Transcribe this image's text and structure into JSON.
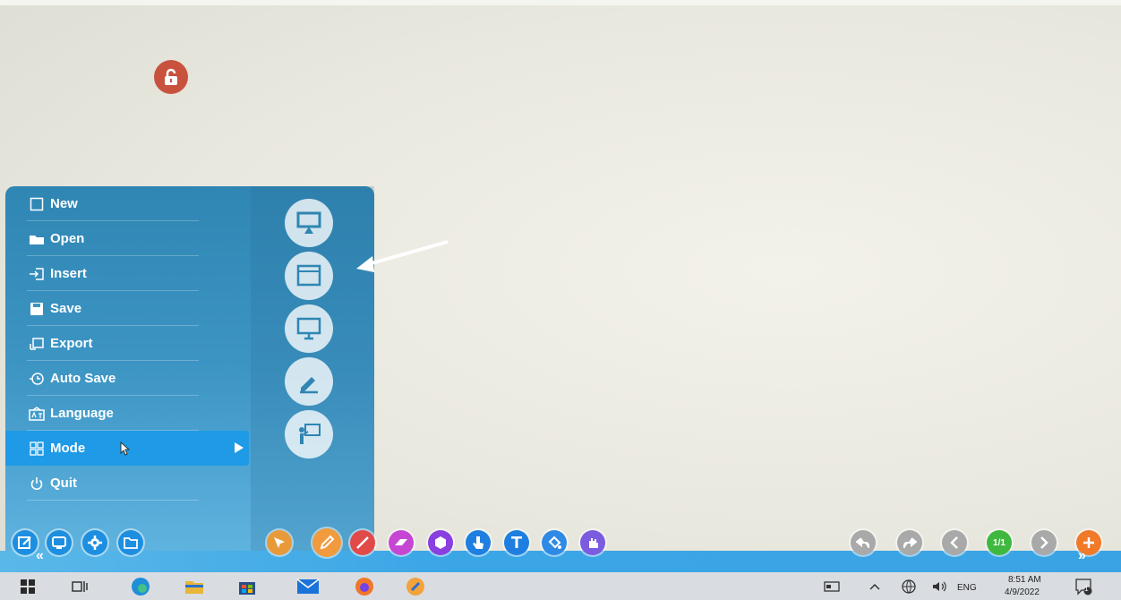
{
  "menu": {
    "items": [
      {
        "label": "New",
        "icon": "new-file-icon"
      },
      {
        "label": "Open",
        "icon": "folder-icon"
      },
      {
        "label": "Insert",
        "icon": "insert-icon"
      },
      {
        "label": "Save",
        "icon": "save-icon"
      },
      {
        "label": "Export",
        "icon": "export-icon"
      },
      {
        "label": "Auto Save",
        "icon": "auto-save-icon"
      },
      {
        "label": "Language",
        "icon": "language-icon"
      },
      {
        "label": "Mode",
        "icon": "mode-grid-icon",
        "active": true
      },
      {
        "label": "Quit",
        "icon": "power-icon"
      }
    ]
  },
  "submenu": {
    "items": [
      {
        "icon": "presentation-board-icon"
      },
      {
        "icon": "window-mode-icon"
      },
      {
        "icon": "desktop-monitor-icon"
      },
      {
        "icon": "pen-annotate-icon"
      },
      {
        "icon": "teacher-board-icon"
      }
    ]
  },
  "toolbar": {
    "left_buttons": [
      {
        "icon": "edit-icon",
        "color": "#1e8fe0"
      },
      {
        "icon": "screen-icon",
        "color": "#1e8fe0"
      },
      {
        "icon": "settings-gear-icon",
        "color": "#1e8fe0"
      },
      {
        "icon": "open-folder-icon",
        "color": "#1e8fe0"
      }
    ],
    "tools": [
      {
        "icon": "select-pointer-icon",
        "color": "#e89a3a"
      },
      {
        "icon": "pencil-icon",
        "color": "#f19a3e"
      },
      {
        "icon": "line-pen-icon",
        "color": "#e24a4a"
      },
      {
        "icon": "eraser-icon",
        "color": "#c646d4"
      },
      {
        "icon": "shape-hexagon-icon",
        "color": "#8a3fe0"
      },
      {
        "icon": "hand-touch-icon",
        "color": "#1e7fe0"
      },
      {
        "icon": "text-icon",
        "color": "#1e7fe0"
      },
      {
        "icon": "fill-bucket-icon",
        "color": "#2f8ae6"
      },
      {
        "icon": "hand-drag-icon",
        "color": "#7b5be0"
      }
    ],
    "page_indicator": "1/1",
    "colors": {
      "undo": "#a9a9a9",
      "next": "#a9a9a9",
      "page": "#3fb83f",
      "add": "#f07a28"
    }
  },
  "taskbar": {
    "apps": [
      "windows-start-icon",
      "task-view-icon",
      "edge-browser-icon",
      "file-explorer-icon",
      "store-icon",
      "mail-icon",
      "firefox-icon",
      "whiteboard-app-icon"
    ],
    "language": "ENG",
    "time": "8:51 AM",
    "date": "4/9/2022",
    "notification_count": "1"
  }
}
